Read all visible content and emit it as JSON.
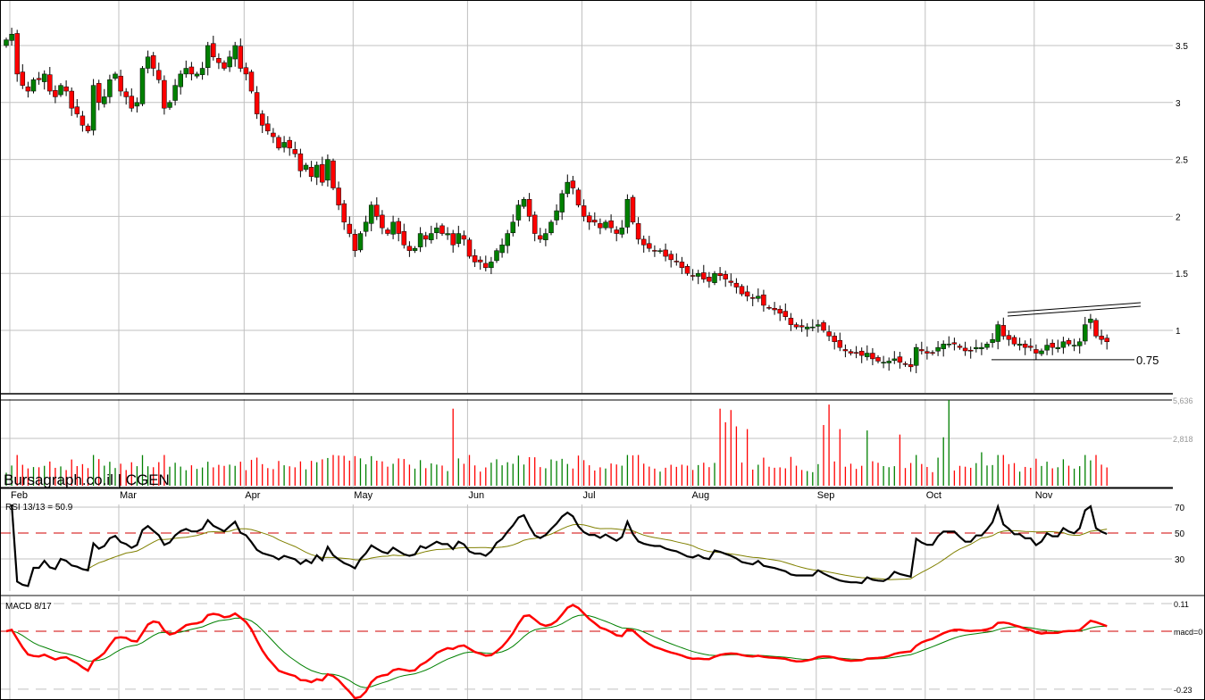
{
  "chart_data": {
    "type": "candlestick",
    "title": "Bursagraph.co.il | CGEN",
    "months": [
      "Feb",
      "Mar",
      "Apr",
      "May",
      "Jun",
      "Jul",
      "Aug",
      "Sep",
      "Oct",
      "Nov"
    ],
    "month_start_index": [
      0,
      20,
      43,
      63,
      84,
      105,
      125,
      148,
      168,
      188
    ],
    "price_ticks": [
      "3.5",
      "3",
      "2.5",
      "2",
      "1.5",
      "1"
    ],
    "price_tick_values": [
      3.5,
      3,
      2.5,
      2,
      1.5,
      1
    ],
    "ylim": [
      0.6,
      3.9
    ],
    "close": [
      3.55,
      3.6,
      3.25,
      3.15,
      3.1,
      3.2,
      3.2,
      3.25,
      3.1,
      3.05,
      3.15,
      3.1,
      2.95,
      2.9,
      2.8,
      2.75,
      3.15,
      3.0,
      3.05,
      3.2,
      3.25,
      3.1,
      3.05,
      2.95,
      3.0,
      3.3,
      3.4,
      3.3,
      3.2,
      2.95,
      3.0,
      3.15,
      3.25,
      3.3,
      3.25,
      3.25,
      3.3,
      3.5,
      3.4,
      3.35,
      3.3,
      3.4,
      3.5,
      3.3,
      3.25,
      3.1,
      2.9,
      2.8,
      2.75,
      2.7,
      2.6,
      2.65,
      2.6,
      2.55,
      2.4,
      2.45,
      2.35,
      2.45,
      2.3,
      2.5,
      2.25,
      2.1,
      1.95,
      1.85,
      1.7,
      1.85,
      1.95,
      2.1,
      2.0,
      1.9,
      1.85,
      1.95,
      1.85,
      1.75,
      1.7,
      1.72,
      1.85,
      1.8,
      1.85,
      1.9,
      1.85,
      1.85,
      1.75,
      1.85,
      1.8,
      1.65,
      1.6,
      1.6,
      1.55,
      1.6,
      1.7,
      1.75,
      1.85,
      1.95,
      2.1,
      2.15,
      2.0,
      1.85,
      1.8,
      1.85,
      1.95,
      2.05,
      2.2,
      2.3,
      2.25,
      2.1,
      2.0,
      1.95,
      1.95,
      1.9,
      1.95,
      1.9,
      1.85,
      1.9,
      2.15,
      1.95,
      1.8,
      1.75,
      1.72,
      1.7,
      1.7,
      1.65,
      1.62,
      1.6,
      1.55,
      1.5,
      1.48,
      1.5,
      1.45,
      1.43,
      1.5,
      1.48,
      1.45,
      1.42,
      1.38,
      1.32,
      1.3,
      1.28,
      1.3,
      1.22,
      1.2,
      1.18,
      1.15,
      1.12,
      1.05,
      1.03,
      1.03,
      1.03,
      1.03,
      1.05,
      1.0,
      0.95,
      0.9,
      0.85,
      0.82,
      0.8,
      0.8,
      0.78,
      0.8,
      0.75,
      0.73,
      0.72,
      0.73,
      0.75,
      0.72,
      0.7,
      0.68,
      0.85,
      0.82,
      0.8,
      0.8,
      0.85,
      0.88,
      0.88,
      0.88,
      0.85,
      0.82,
      0.82,
      0.85,
      0.85,
      0.88,
      0.92,
      1.05,
      0.95,
      0.92,
      0.88,
      0.88,
      0.85,
      0.85,
      0.8,
      0.82,
      0.87,
      0.85,
      0.85,
      0.9,
      0.88,
      0.87,
      0.9,
      1.05,
      1.1,
      0.95,
      0.92,
      0.9
    ],
    "volume": {
      "ticks": [
        "5,636",
        "2,818"
      ],
      "tick_values": [
        5636,
        2818
      ],
      "spikes": {
        "82": 5000,
        "131": 5000,
        "133": 4900,
        "132": 4000,
        "134": 3700,
        "136": 3500,
        "150": 3800,
        "151": 5300,
        "153": 3500,
        "172": 2900,
        "173": 5636,
        "158": 3400,
        "179": 1800,
        "164": 3100
      }
    },
    "support_label": "0.75",
    "support_value": 0.75,
    "rsi": {
      "label": "RSI 13/13 = 50.9",
      "period": 13,
      "ticks": [
        "70",
        "50",
        "30"
      ],
      "tick_values": [
        70,
        50,
        30
      ]
    },
    "macd": {
      "label": "MACD 8/17",
      "fast": 8,
      "slow": 17,
      "ticks": [
        "0.11",
        "macd=0",
        "-0.23"
      ],
      "tick_values": [
        0.11,
        0,
        -0.23
      ]
    },
    "colors": {
      "up": "#008000",
      "down": "#ff0000",
      "grid": "#c0c0c0",
      "signal": "#808000",
      "macd": "#ff0000",
      "macd_signal": "#008000"
    }
  }
}
